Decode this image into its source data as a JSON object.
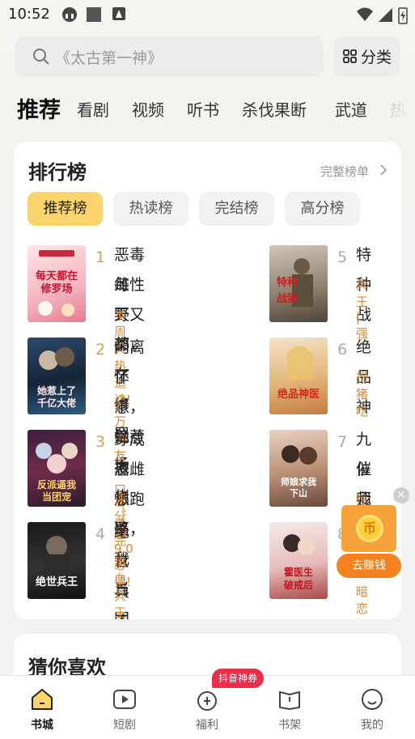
{
  "status_bar": {
    "time": "10:52"
  },
  "search": {
    "placeholder": "《太古第一神》",
    "category_label": "分类"
  },
  "tabs": [
    "推荐",
    "看剧",
    "视频",
    "听书",
    "杀伐果断",
    "武道",
    "热"
  ],
  "ranking": {
    "title": "排行榜",
    "more_label": "完整榜单",
    "filters": [
      "推荐榜",
      "热读榜",
      "完结榜",
      "高分榜"
    ],
    "active_filter": "推荐榜",
    "items": [
      {
        "rank": "1",
        "line1": "恶毒雌性野又茶，",
        "line2": "每天都在修罗场",
        "sub": "本周火热追读!",
        "cover_text": "每天都在修罗场"
      },
      {
        "rank": "2",
        "line1": "闪离怀崽，她惹上",
        "line2": "了千亿大佬",
        "sub": "2万书友一口气读完",
        "cover_text": "她惹上了千亿大佬"
      },
      {
        "rank": "3",
        "line1": "穿成恶雌想跑路，",
        "line2": "反派逼我当团宠",
        "sub": "评分超9.0必读!",
        "cover_text": "反派逼我当团宠"
      },
      {
        "rank": "4",
        "line1": "绝世兵王",
        "line2": "",
        "sub": "热血兵王类巅峰",
        "cover_text": "绝世兵王"
      },
      {
        "rank": "5",
        "line1": "特种战",
        "line2": "",
        "sub": "兵王 | 强",
        "cover_text": "特种战狼"
      },
      {
        "rank": "6",
        "line1": "绝品神",
        "line2": "",
        "sub": "扮猪吃",
        "cover_text": "绝品神医"
      },
      {
        "rank": "7",
        "line1": "九位师",
        "line2": "催我下",
        "sub": "惊艳万",
        "cover_text": "师娘求我下山"
      },
      {
        "rank": "8",
        "line1": "",
        "line2": "",
        "sub": "暗恋 | 甜",
        "cover_text": "霍医生破戒后"
      }
    ]
  },
  "guess": {
    "title": "猜你喜欢"
  },
  "reward": {
    "label": "去赚钱",
    "coin": "币"
  },
  "nav": {
    "items": [
      "书城",
      "短剧",
      "福利",
      "书架",
      "我的"
    ],
    "active": "书城",
    "badge": "抖音神券"
  },
  "colors": {
    "accent": "#fbd46e",
    "rank": "#d9a24a",
    "sub": "#d68b3c",
    "badge": "#ef2c4a"
  }
}
